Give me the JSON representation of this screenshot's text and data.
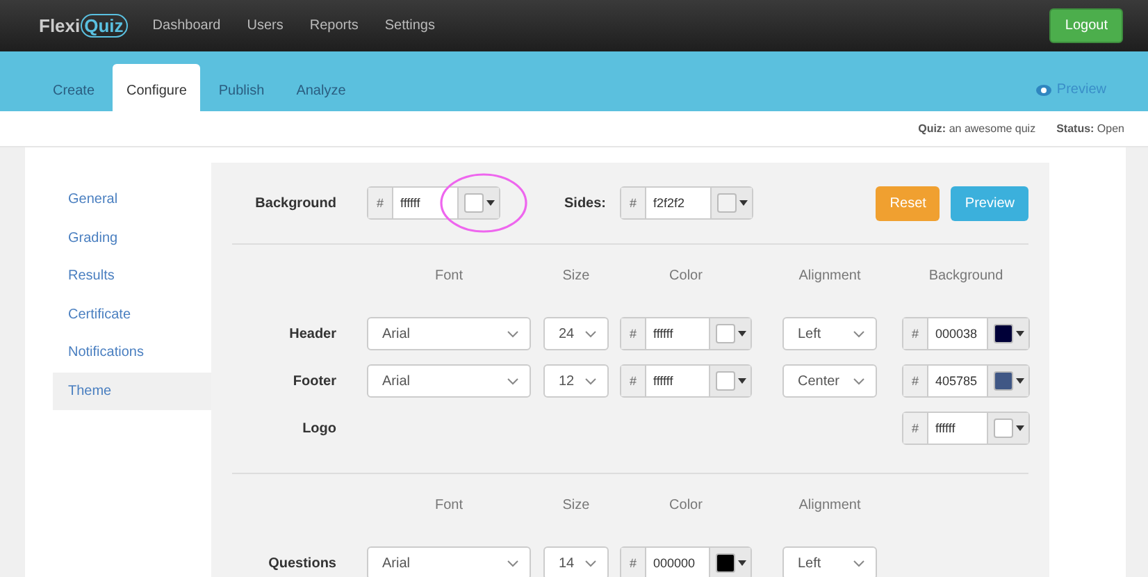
{
  "navbar": {
    "logo": {
      "text": "Flexi",
      "highlight": "Quiz"
    },
    "links": [
      "Dashboard",
      "Users",
      "Reports",
      "Settings"
    ],
    "logout": "Logout"
  },
  "tabs": [
    {
      "label": "Create",
      "selected": false
    },
    {
      "label": "Configure",
      "selected": true
    },
    {
      "label": "Publish",
      "selected": false
    },
    {
      "label": "Analyze",
      "selected": false
    }
  ],
  "preview_link": "Preview",
  "quiz_info": [
    {
      "label": "Quiz:",
      "value": "an awesome quiz"
    },
    {
      "label": "Status:",
      "value": "Open"
    }
  ],
  "sidebar": {
    "items": [
      {
        "label": "General",
        "selected": false
      },
      {
        "label": "Grading",
        "selected": false
      },
      {
        "label": "Results",
        "selected": false
      },
      {
        "label": "Certificate",
        "selected": false
      },
      {
        "label": "Notifications",
        "selected": false
      },
      {
        "label": "Theme",
        "selected": true
      }
    ]
  },
  "page_colors": [
    {
      "label": "Background",
      "prefix": "#",
      "value": "ffffff",
      "color": "#ffffff",
      "highlighted": true
    },
    {
      "label": "Sides:",
      "prefix": "#",
      "value": "f2f2f2",
      "color": "#f2f2f2",
      "highlighted": false
    }
  ],
  "buttons": {
    "reset": "Reset",
    "preview": "Preview"
  },
  "sections": [
    {
      "columns": [
        "Font",
        "Size",
        "Color",
        "Alignment",
        "Background"
      ],
      "rows": [
        {
          "label": "Header",
          "font": "Arial",
          "size": "24",
          "text_color": {
            "prefix": "#",
            "value": "ffffff",
            "color": "#ffffff"
          },
          "alignment": "Left",
          "background": {
            "prefix": "#",
            "value": "000038",
            "color": "#000038"
          }
        },
        {
          "label": "Footer",
          "font": "Arial",
          "size": "12",
          "text_color": {
            "prefix": "#",
            "value": "ffffff",
            "color": "#ffffff"
          },
          "alignment": "Center",
          "background": {
            "prefix": "#",
            "value": "405785",
            "color": "#405785"
          }
        },
        {
          "label": "Logo",
          "background": {
            "prefix": "#",
            "value": "ffffff",
            "color": "#ffffff"
          }
        }
      ]
    },
    {
      "columns": [
        "Font",
        "Size",
        "Color",
        "Alignment"
      ],
      "rows": [
        {
          "label": "Questions",
          "font": "Arial",
          "size": "14",
          "text_color": {
            "prefix": "#",
            "value": "000000",
            "color": "#000000"
          },
          "alignment": "Left"
        }
      ]
    }
  ]
}
